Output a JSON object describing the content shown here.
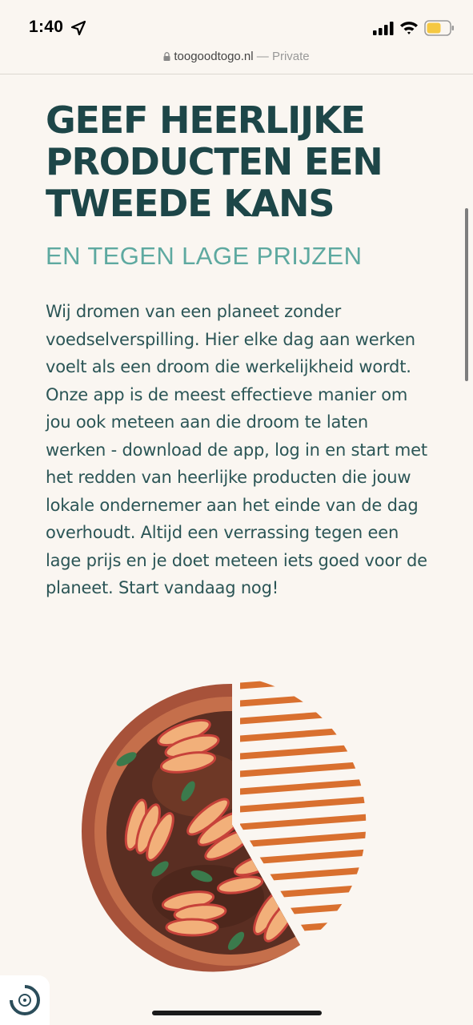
{
  "status_bar": {
    "time": "1:40",
    "icons": [
      "location-arrow-icon",
      "cellular-signal-icon",
      "wifi-icon",
      "battery-icon"
    ],
    "battery_color": "#f5c842"
  },
  "browser": {
    "domain": "toogoodtogo.nl",
    "separator": " — ",
    "mode": "Private"
  },
  "hero": {
    "headline": "GEEF HEERLIJKE PRODUCTEN EEN TWEEDE KANS",
    "subheadline": "EN TEGEN LAGE PRIJZEN",
    "body": "Wij dromen van een planeet zonder voedselverspilling. Hier elke dag aan werken voelt als een droom die werkelijkheid wordt. Onze app is de meest effectieve manier om jou ook meteen aan die droom te laten werken - download de app, log in en start met het redden van heerlijke producten die jouw lokale ondernemer aan het einde van de dag overhoudt. Altijd een verrassing tegen een lage prijs en je doet meteen iets goed voor de planeet. Start vandaag nog!"
  },
  "illustration": {
    "name": "peach-tart-illustration",
    "colors": {
      "crust": "#a7523a",
      "filling": "#5a2e22",
      "peach": "#f2b07a",
      "leaf": "#3b7a4c",
      "stripes": "#d9702f"
    }
  },
  "colors": {
    "background": "#faf6f1",
    "headline": "#1d4648",
    "accent": "#5ea9a0"
  }
}
